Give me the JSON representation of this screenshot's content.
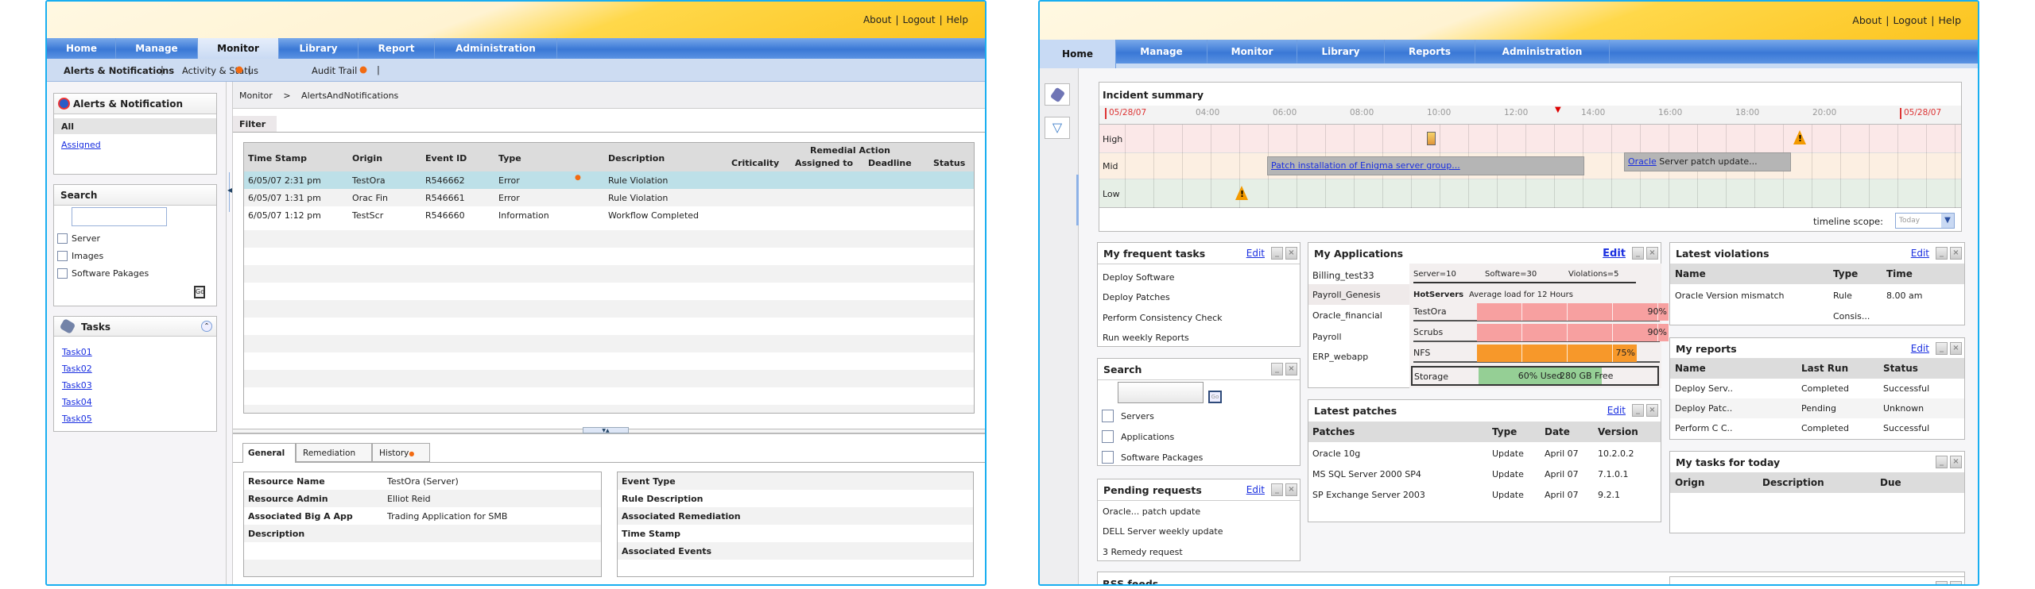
{
  "left": {
    "top_links": [
      "About",
      "Logout",
      "Help"
    ],
    "nav": [
      "Home",
      "Manage",
      "Monitor",
      "Library",
      "Report",
      "Administration"
    ],
    "subnav": [
      "Alerts & Notifications",
      "Activity & Status",
      "Audit Trail"
    ],
    "alerts_box": {
      "title": "Alerts & Notification",
      "items": [
        "All",
        "Assigned"
      ]
    },
    "search_box": {
      "title": "Search",
      "input_value": "",
      "options": [
        "Server",
        "Images",
        "Software Pakages"
      ],
      "go": "Go"
    },
    "tasks_box": {
      "title": "Tasks",
      "items": [
        "Task01",
        "Task02",
        "Task03",
        "Task04",
        "Task05"
      ]
    },
    "breadcrumb": [
      "Monitor",
      ">",
      "AlertsAndNotifications"
    ],
    "filter_label": "Filter",
    "table": {
      "headers": [
        "Time Stamp",
        "Origin",
        "Event ID",
        "Type",
        "Description",
        "Criticality",
        "Assigned to",
        "Deadline",
        "Status"
      ],
      "group_header": "Remedial Action",
      "rows": [
        [
          "6/05/07 2:31 pm",
          "TestOra",
          "R546662",
          "Error",
          "Rule Violation"
        ],
        [
          "6/05/07 1:31 pm",
          "Orac Fin",
          "R546661",
          "Error",
          "Rule Violation"
        ],
        [
          "6/05/07 1:12 pm",
          "TestScr",
          "R546660",
          "Information",
          "Workflow Completed"
        ]
      ]
    },
    "detail_tabs": [
      "General",
      "Remediation",
      "History"
    ],
    "detail_left": [
      [
        "Resource Name",
        "TestOra (Server)"
      ],
      [
        "Resource Admin",
        "Elliot Reid"
      ],
      [
        "Associated Big A App",
        "Trading Application for SMB"
      ],
      [
        "Description",
        ""
      ]
    ],
    "detail_right": [
      "Event Type",
      "Rule Description",
      "Associated Remediation",
      "Time Stamp",
      "Associated Events"
    ]
  },
  "right": {
    "top_links": [
      "About",
      "Logout",
      "Help"
    ],
    "nav": [
      "Home",
      "Manage",
      "Monitor",
      "Library",
      "Reports",
      "Administration"
    ],
    "incident": {
      "title": "Incident summary",
      "ticks": [
        "05/28/07",
        "04:00",
        "06:00",
        "08:00",
        "10:00",
        "12:00",
        "14:00",
        "16:00",
        "18:00",
        "20:00",
        "05/28/07"
      ],
      "rows": [
        "High",
        "Mid",
        "Low"
      ],
      "mid_event1": "Patch installation of Enigma server group...",
      "mid_event2_link": "Oracle",
      "mid_event2_text": "Server patch update...",
      "scope_label": "timeline scope:",
      "scope_value": "Today"
    },
    "frequent": {
      "title": "My frequent tasks",
      "edit": "Edit",
      "items": [
        "Deploy Software",
        "Deploy Patches",
        "Perform Consistency Check",
        "Run weekly Reports"
      ]
    },
    "search": {
      "title": "Search",
      "go": "Go",
      "options": [
        "Servers",
        "Applications",
        "Software Packages"
      ]
    },
    "pending": {
      "title": "Pending requests",
      "edit": "Edit",
      "items": [
        "Oracle... patch update",
        "DELL Server weekly update",
        "3 Remedy request"
      ]
    },
    "rss": {
      "title": "RSS feeds"
    },
    "apps": {
      "title": "My Applications",
      "edit": "Edit",
      "list": [
        "Billing_test33",
        "Payroll_Genesis",
        "Oracle_financial",
        "Payroll",
        "ERP_webapp"
      ],
      "stats": [
        "Server=10",
        "Software=30",
        "Violations=5"
      ],
      "hot_label": "HotServers",
      "hot_desc": "Average load for 12 Hours",
      "servers": [
        {
          "name": "TestOra",
          "load": 90,
          "label": "90%"
        },
        {
          "name": "Scrubs",
          "load": 90,
          "label": "90%"
        },
        {
          "name": "NFS",
          "load": 75,
          "label": "75%"
        }
      ],
      "storage": {
        "label": "Storage",
        "used_pct": 60,
        "used": "60% Used",
        "free": "280 GB Free"
      },
      "colors": {
        "high": "#f7a0a0",
        "mid": "#f7982a",
        "used": "#95cf95"
      }
    },
    "patches": {
      "title": "Latest patches",
      "edit": "Edit",
      "headers": [
        "Patches",
        "Type",
        "Date",
        "Version"
      ],
      "rows": [
        [
          "Oracle 10g",
          "Update",
          "April 07",
          "10.2.0.2"
        ],
        [
          "MS SQL Server 2000 SP4",
          "Update",
          "April 07",
          "7.1.0.1"
        ],
        [
          "SP Exchange Server 2003",
          "Update",
          "April 07",
          "9.2.1"
        ]
      ]
    },
    "violations": {
      "title": "Latest violations",
      "edit": "Edit",
      "headers": [
        "Name",
        "Type",
        "Time"
      ],
      "rows": [
        [
          "Oracle Version mismatch",
          "Rule",
          "8.00 am"
        ],
        [
          "",
          "Consis...",
          ""
        ]
      ]
    },
    "reports": {
      "title": "My reports",
      "edit": "Edit",
      "headers": [
        "Name",
        "Last Run",
        "Status"
      ],
      "rows": [
        [
          "Deploy Serv..",
          "Completed",
          "Successful"
        ],
        [
          "Deploy Patc..",
          "Pending",
          "Unknown"
        ],
        [
          "Perform C C..",
          "Completed",
          "Successful"
        ]
      ]
    },
    "today": {
      "title": "My tasks for today",
      "headers": [
        "Orign",
        "Description",
        "Due"
      ]
    }
  }
}
